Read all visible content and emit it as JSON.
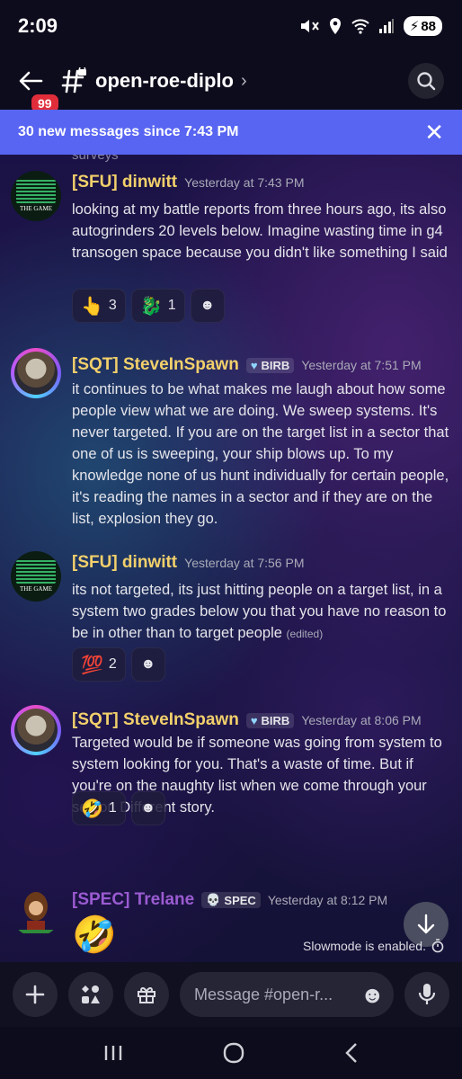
{
  "status_bar": {
    "time": "2:09",
    "battery": "88"
  },
  "header": {
    "channel": "open-roe-diplo",
    "unread_badge": "99"
  },
  "new_messages_bar": {
    "text": "30 new messages since 7:43 PM"
  },
  "cut_off_text": "surveys",
  "messages": [
    {
      "author": "[SFU] dinwitt",
      "timestamp": "Yesterday at 7:43 PM",
      "text": "looking at my battle reports from three hours ago, its also autogrinders 20 levels below.  Imagine wasting time in g4 transogen space because you didn't like something I said",
      "reactions": [
        {
          "emoji": "👆",
          "count": "3"
        },
        {
          "emoji": "🐉",
          "count": "1"
        }
      ]
    },
    {
      "author": "[SQT] SteveInSpawn",
      "tag": "BIRB",
      "timestamp": "Yesterday at 7:51 PM",
      "text": "it continues to be what makes me laugh about how some people view what we are doing. We sweep systems. It's never targeted. If you are on the target list in a sector that one of us is sweeping, your ship blows up. To my knowledge none of us hunt individually for certain people, it's reading the names in a sector and if they are on the list, explosion they go."
    },
    {
      "author": "[SFU] dinwitt",
      "timestamp": "Yesterday at 7:56 PM",
      "text": "its not targeted, its just hitting people on a target list, in a system two grades below you that you have no reason to be in other than to target people",
      "edited": "(edited)",
      "reactions": [
        {
          "emoji": "💯",
          "count": "2"
        }
      ]
    },
    {
      "author": "[SQT] SteveInSpawn",
      "tag": "BIRB",
      "timestamp": "Yesterday at 8:06 PM",
      "text": "Targeted would be if someone was going from system to system looking for you. That's a waste of time. But if you're on the naughty list when we come through your sector. Different story.",
      "reactions": [
        {
          "emoji": "🤣",
          "count": "1"
        }
      ]
    },
    {
      "author": "[SPEC] Trelane",
      "tag": "SPEC",
      "timestamp": "Yesterday at 8:12 PM",
      "emoji": "🤣"
    }
  ],
  "slowmode": "Slowmode is enabled.",
  "composer": {
    "placeholder": "Message #open-r..."
  }
}
